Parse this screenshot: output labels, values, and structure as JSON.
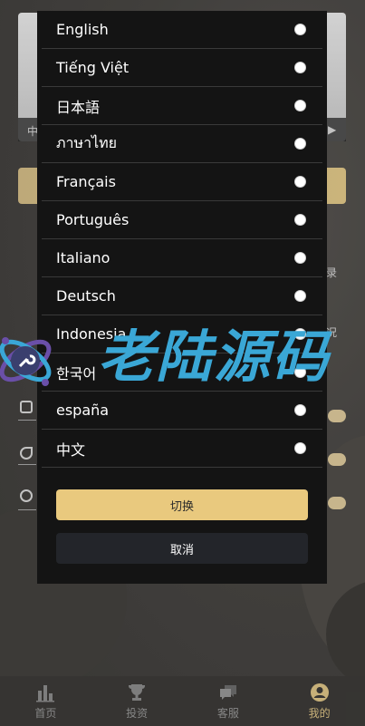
{
  "background": {
    "banner_caption_left": "中",
    "banner_arrow": "▶",
    "side_label_record": "录",
    "side_label_status": "况"
  },
  "language_modal": {
    "options": [
      {
        "label": "English"
      },
      {
        "label": "Tiếng Việt"
      },
      {
        "label": "日本語"
      },
      {
        "label": "ภาษาไทย"
      },
      {
        "label": "Français"
      },
      {
        "label": "Português"
      },
      {
        "label": "Italiano"
      },
      {
        "label": "Deutsch"
      },
      {
        "label": "Indonesia"
      },
      {
        "label": "한국어"
      },
      {
        "label": "españa"
      },
      {
        "label": "中文"
      }
    ],
    "switch_label": "切换",
    "cancel_label": "取消"
  },
  "bottom_nav": {
    "items": [
      {
        "label": "首页",
        "icon": "bar-chart-icon",
        "active": false
      },
      {
        "label": "投资",
        "icon": "trophy-icon",
        "active": false
      },
      {
        "label": "客服",
        "icon": "chat-icon",
        "active": false
      },
      {
        "label": "我的",
        "icon": "user-icon",
        "active": true
      }
    ]
  },
  "watermark": {
    "text": "老陆源码"
  },
  "colors": {
    "accent_gold": "#e9c97e",
    "modal_bg": "#141414",
    "cancel_bg": "#23252a",
    "watermark_blue": "#3aa7d6"
  }
}
